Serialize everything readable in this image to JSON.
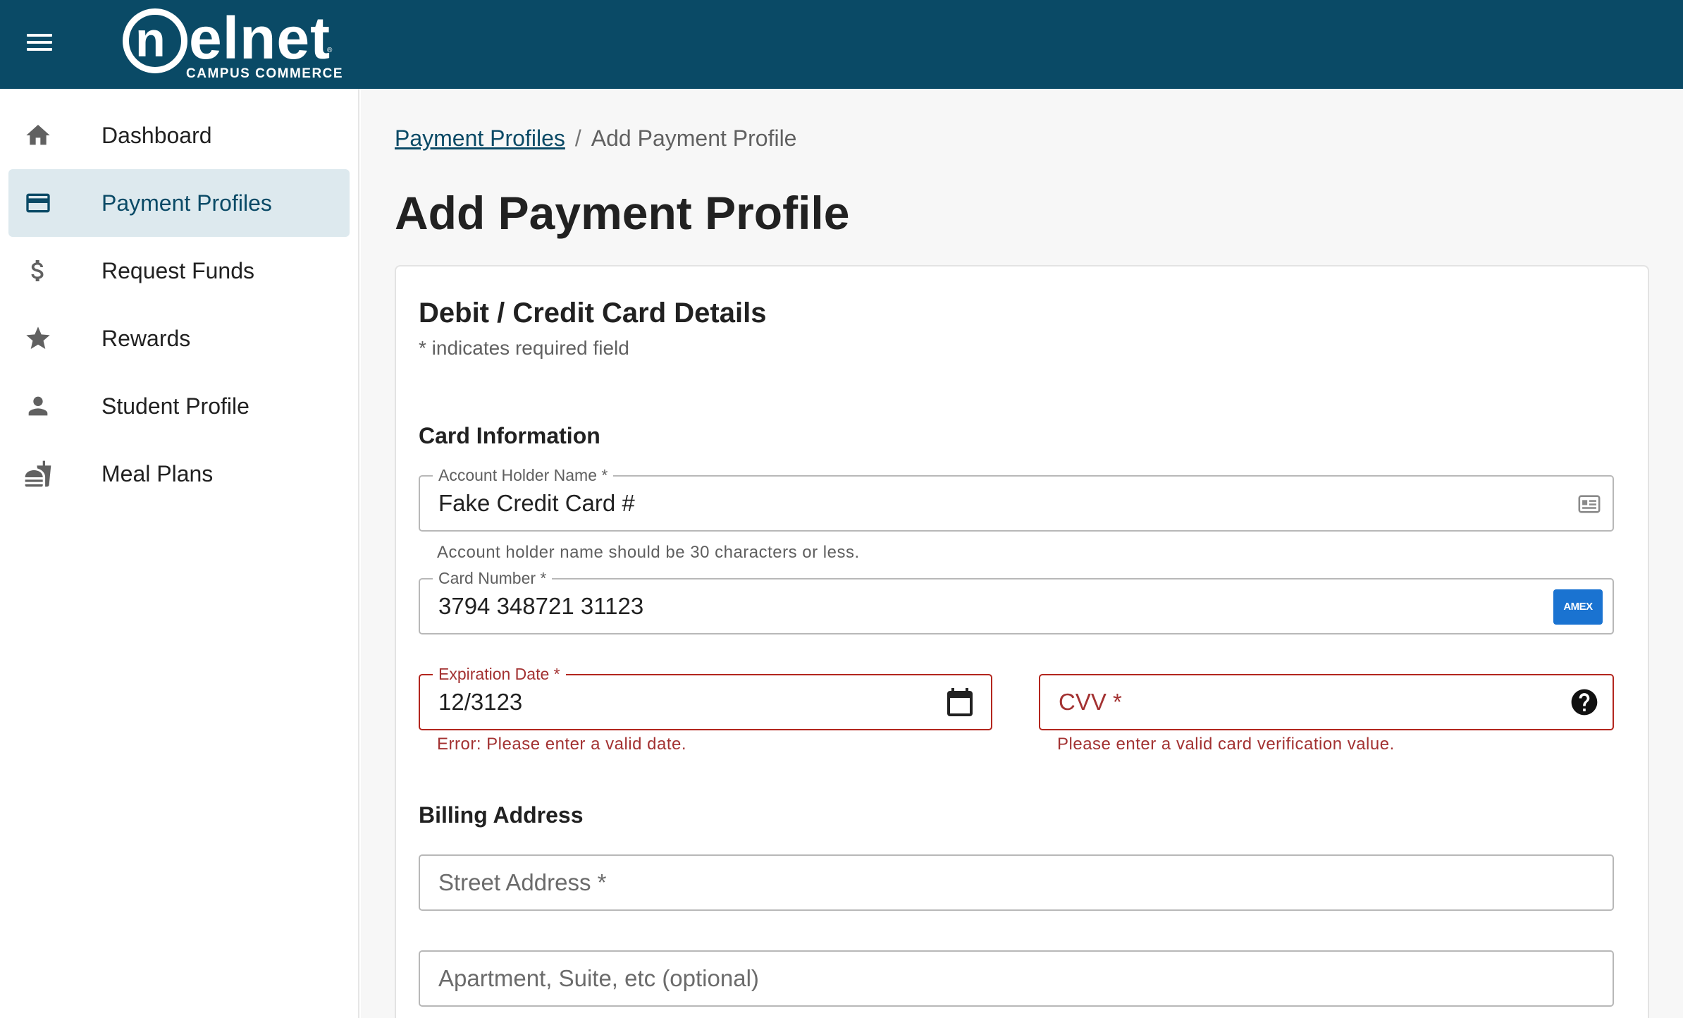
{
  "header": {
    "logo_word": "elnet",
    "logo_letter": "n",
    "logo_subtitle": "CAMPUS COMMERCE",
    "logo_tm": "®",
    "color": "#0a4a66"
  },
  "sidebar": {
    "items": [
      {
        "label": "Dashboard",
        "icon": "home-icon"
      },
      {
        "label": "Payment Profiles",
        "icon": "credit-card-icon",
        "active": true
      },
      {
        "label": "Request Funds",
        "icon": "dollar-icon"
      },
      {
        "label": "Rewards",
        "icon": "star-icon"
      },
      {
        "label": "Student Profile",
        "icon": "person-icon"
      },
      {
        "label": "Meal Plans",
        "icon": "meal-icon"
      }
    ]
  },
  "breadcrumb": {
    "link": "Payment Profiles",
    "separator": "/",
    "current": "Add Payment Profile"
  },
  "page_title": "Add Payment Profile",
  "form": {
    "title": "Debit / Credit Card Details",
    "required_note": "* indicates required field",
    "card_section": "Card Information",
    "account_holder": {
      "label": "Account Holder Name *",
      "value": "Fake Credit Card #",
      "helper": "Account holder name should be 30 characters or less."
    },
    "card_number": {
      "label": "Card Number *",
      "value": "3794 348721 31123",
      "brand": "AMEX"
    },
    "expiration": {
      "label": "Expiration Date *",
      "value": "12/3123",
      "error": "Error: Please enter a valid date."
    },
    "cvv": {
      "placeholder": "CVV *",
      "error": "Please enter a valid card verification value."
    },
    "billing_section": "Billing Address",
    "street": {
      "placeholder": "Street Address *"
    },
    "apartment": {
      "placeholder": "Apartment, Suite, etc (optional)"
    }
  },
  "colors": {
    "primary": "#0a4a66",
    "error": "#a33232",
    "active_nav_bg": "#dde9ee",
    "amex_blue": "#1a73d1"
  }
}
